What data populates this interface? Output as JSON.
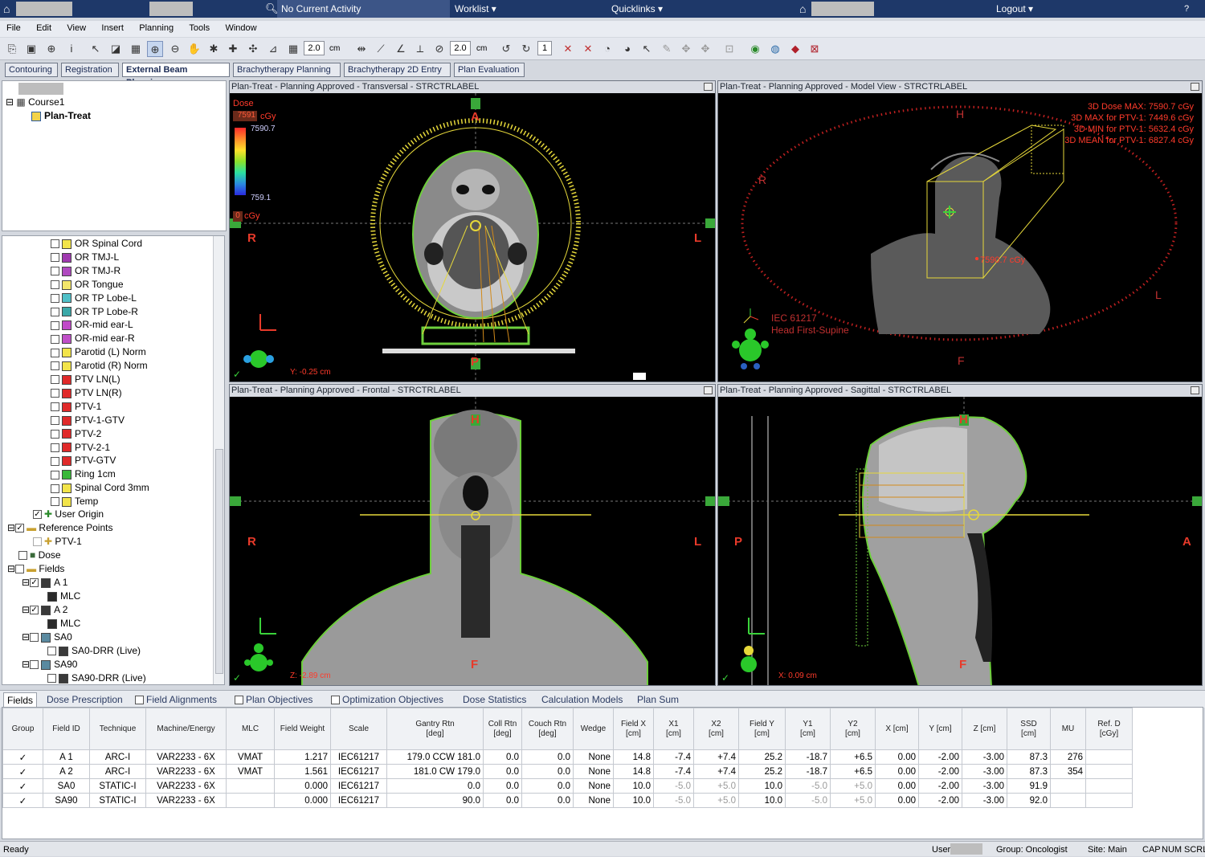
{
  "topbar": {
    "activity": "No Current Activity",
    "worklist": "Worklist",
    "quicklinks": "Quicklinks",
    "logout": "Logout"
  },
  "menu": [
    "File",
    "Edit",
    "View",
    "Insert",
    "Planning",
    "Tools",
    "Window"
  ],
  "toolbar": {
    "field1": "2.0",
    "unit1": "cm",
    "field2": "2.0",
    "unit2": "cm",
    "field3": "1"
  },
  "workspace_tabs": [
    "Contouring",
    "Registration",
    "External Beam Planning",
    "Brachytherapy Planning",
    "Brachytherapy 2D Entry",
    "Plan Evaluation"
  ],
  "tree_top": {
    "course": "Course1",
    "plan": "Plan-Treat"
  },
  "structures": [
    {
      "label": "OR Spinal Cord",
      "color": "#f2e44a"
    },
    {
      "label": "OR TMJ-L",
      "color": "#a03ab0"
    },
    {
      "label": "OR TMJ-R",
      "color": "#b04ac0"
    },
    {
      "label": "OR Tongue",
      "color": "#f3e66a"
    },
    {
      "label": "OR TP Lobe-L",
      "color": "#4fc0c8"
    },
    {
      "label": "OR TP Lobe-R",
      "color": "#3aa8a8"
    },
    {
      "label": "OR-mid ear-L",
      "color": "#c04ac8"
    },
    {
      "label": "OR-mid ear-R",
      "color": "#c050c8"
    },
    {
      "label": "Parotid (L) Norm",
      "color": "#f2e44a"
    },
    {
      "label": "Parotid (R) Norm",
      "color": "#f2e44a"
    },
    {
      "label": "PTV LN(L)",
      "color": "#e02a2a"
    },
    {
      "label": "PTV LN(R)",
      "color": "#e02a2a"
    },
    {
      "label": "PTV-1",
      "color": "#e02a2a"
    },
    {
      "label": "PTV-1-GTV",
      "color": "#e02a2a"
    },
    {
      "label": "PTV-2",
      "color": "#e02a2a"
    },
    {
      "label": "PTV-2-1",
      "color": "#e02a2a"
    },
    {
      "label": "PTV-GTV",
      "color": "#e02a2a"
    },
    {
      "label": "Ring 1cm",
      "color": "#3ab83a"
    },
    {
      "label": "Spinal Cord 3mm",
      "color": "#f2e44a"
    },
    {
      "label": "Temp",
      "color": "#f2e44a"
    }
  ],
  "tree_items": {
    "user_origin": "User Origin",
    "reference_points": "Reference Points",
    "ref_ptv": "PTV-1",
    "dose": "Dose",
    "fields": "Fields",
    "a1": "A 1",
    "mlc1": "MLC",
    "a2": "A 2",
    "mlc2": "MLC",
    "sa0": "SA0",
    "sa0drr": "SA0-DRR (Live)",
    "sa90": "SA90",
    "sa90drr": "SA90-DRR (Live)"
  },
  "viewers": {
    "transversal": {
      "title": "Plan-Treat  -  Planning Approved - Transversal - STRCTRLABEL",
      "dose_label": "Dose",
      "dose_ref": "7591",
      "dose_unit": "cGy",
      "dose_max": "7590.7",
      "dose_min": "759.1",
      "dose_zero": "0",
      "dose_zero_unit": "cGy",
      "top": "A",
      "bottom": "P",
      "left": "R",
      "right": "L",
      "coord": "Y: -0.25 cm",
      "check": "✓"
    },
    "model": {
      "title": "Plan-Treat  -  Planning Approved  -  Model View - STRCTRLABEL",
      "stats": [
        "3D Dose MAX: 7590.7 cGy",
        "3D MAX for PTV-1: 7449.6 cGy",
        "3D MIN for PTV-1: 5632.4 cGy",
        "3D MEAN for PTV-1: 6827.4 cGy"
      ],
      "point_dose": "7590.7 cGy",
      "top": "H",
      "bottom": "F",
      "left": "R",
      "right": "L",
      "orient1": "IEC 61217",
      "orient2": "Head First-Supine"
    },
    "frontal": {
      "title": "Plan-Treat  -  Planning Approved - Frontal - STRCTRLABEL",
      "top": "H",
      "bottom": "F",
      "left": "R",
      "right": "L",
      "coord": "Z: -2.89 cm",
      "check": "✓"
    },
    "sagittal": {
      "title": "Plan-Treat  -  Planning Approved - Sagittal - STRCTRLABEL",
      "top": "H",
      "bottom": "F",
      "left": "P",
      "right": "A",
      "coord": "X: 0.09 cm",
      "check": "✓"
    }
  },
  "bottom_tabs": [
    "Fields",
    "Dose Prescription",
    "Field Alignments",
    "Plan Objectives",
    "Optimization Objectives",
    "Dose Statistics",
    "Calculation Models",
    "Plan Sum"
  ],
  "table": {
    "headers": [
      "Group",
      "Field ID",
      "Technique",
      "Machine/Energy",
      "MLC",
      "Field Weight",
      "Scale",
      "Gantry Rtn\n[deg]",
      "Coll Rtn\n[deg]",
      "Couch Rtn\n[deg]",
      "Wedge",
      "Field X\n[cm]",
      "X1\n[cm]",
      "X2\n[cm]",
      "Field Y\n[cm]",
      "Y1\n[cm]",
      "Y2\n[cm]",
      "X [cm]",
      "Y [cm]",
      "Z [cm]",
      "SSD\n[cm]",
      "MU",
      "Ref. D\n[cGy]"
    ],
    "rows": [
      [
        "✓",
        "A 1",
        "ARC-I",
        "VAR2233 - 6X",
        "VMAT",
        "1.217",
        "IEC61217",
        "179.0 CCW 181.0",
        "0.0",
        "0.0",
        "None",
        "14.8",
        "-7.4",
        "+7.4",
        "25.2",
        "-18.7",
        "+6.5",
        "0.00",
        "-2.00",
        "-3.00",
        "87.3",
        "276",
        ""
      ],
      [
        "✓",
        "A 2",
        "ARC-I",
        "VAR2233 - 6X",
        "VMAT",
        "1.561",
        "IEC61217",
        "181.0 CW 179.0",
        "0.0",
        "0.0",
        "None",
        "14.8",
        "-7.4",
        "+7.4",
        "25.2",
        "-18.7",
        "+6.5",
        "0.00",
        "-2.00",
        "-3.00",
        "87.3",
        "354",
        ""
      ],
      [
        "✓",
        "SA0",
        "STATIC-I",
        "VAR2233 - 6X",
        "",
        "0.000",
        "IEC61217",
        "0.0",
        "0.0",
        "0.0",
        "None",
        "10.0",
        "-5.0",
        "+5.0",
        "10.0",
        "-5.0",
        "+5.0",
        "0.00",
        "-2.00",
        "-3.00",
        "91.9",
        "",
        ""
      ],
      [
        "✓",
        "SA90",
        "STATIC-I",
        "VAR2233 - 6X",
        "",
        "0.000",
        "IEC61217",
        "90.0",
        "0.0",
        "0.0",
        "None",
        "10.0",
        "-5.0",
        "+5.0",
        "10.0",
        "-5.0",
        "+5.0",
        "0.00",
        "-2.00",
        "-3.00",
        "92.0",
        "",
        ""
      ]
    ]
  },
  "status": {
    "ready": "Ready",
    "user": "User",
    "group": "Group: Oncologist",
    "site": "Site: Main",
    "cap": "CAP",
    "num": "NUM",
    "scrl": "SCRL"
  }
}
